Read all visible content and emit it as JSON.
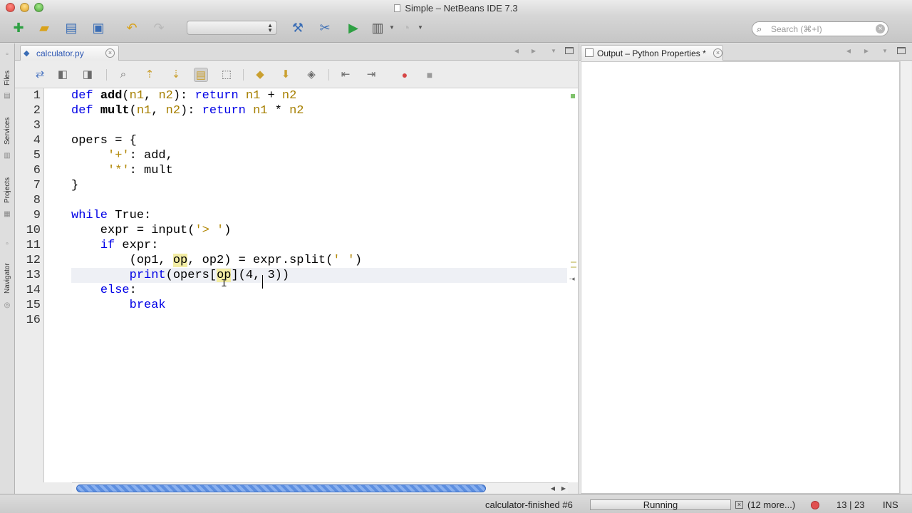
{
  "window": {
    "title": "Simple – NetBeans IDE 7.3"
  },
  "search": {
    "placeholder": "Search (⌘+I)"
  },
  "side_tabs": [
    "Files",
    "Services",
    "Projects",
    "Navigator"
  ],
  "editor": {
    "tab_label": "calculator.py",
    "line_numbers": [
      "1",
      "2",
      "3",
      "4",
      "5",
      "6",
      "7",
      "8",
      "9",
      "10",
      "11",
      "12",
      "13",
      "14",
      "15",
      "16"
    ],
    "current_line": 13,
    "highlight_color": "#f3eda4",
    "keyword_color": "#0000e6",
    "param_color": "#a67f00"
  },
  "output": {
    "tab_label": "Output – Python Properties *"
  },
  "status": {
    "task": "calculator-finished #6",
    "progress_label": "Running",
    "more": "(12 more...)",
    "caret_position": "13 | 23",
    "insert_mode": "INS"
  }
}
